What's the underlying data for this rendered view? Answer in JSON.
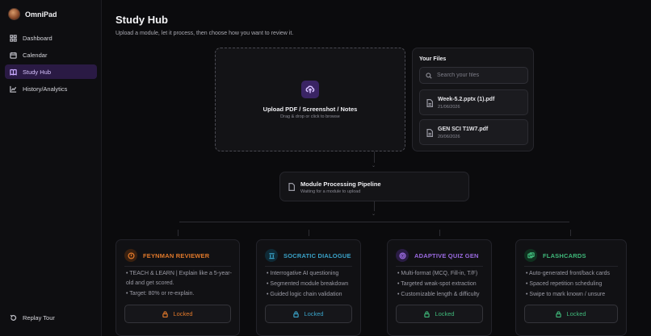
{
  "app": {
    "name": "OmniPad"
  },
  "sidebar": {
    "items": [
      {
        "label": "Dashboard",
        "icon": "grid-icon"
      },
      {
        "label": "Calendar",
        "icon": "calendar-icon"
      },
      {
        "label": "Study Hub",
        "icon": "book-icon",
        "active": true
      },
      {
        "label": "History/Analytics",
        "icon": "chart-icon"
      }
    ],
    "replay_label": "Replay Tour"
  },
  "page": {
    "title": "Study Hub",
    "subtitle": "Upload a module, let it process, then choose how you want to review it."
  },
  "upload": {
    "title": "Upload PDF / Screenshot / Notes",
    "subtitle": "Drag & drop or click to browse"
  },
  "files": {
    "title": "Your Files",
    "search_placeholder": "Search your files",
    "items": [
      {
        "name": "Week-5.2.pptx (1).pdf",
        "date": "21/06/2026"
      },
      {
        "name": "GEN SCI T1W7.pdf",
        "date": "20/06/2026"
      }
    ]
  },
  "pipeline": {
    "title": "Module Processing Pipeline",
    "status": "Waiting for a module to upload"
  },
  "modes": [
    {
      "title": "FEYNMAN REVIEWER",
      "color": "#e0782a",
      "icon": "lightbulb-icon",
      "bullets": [
        "• TEACH & LEARN | Explain like a 5-year-old and get scored.",
        "• Target: 80% or re-explain."
      ],
      "button": "Locked"
    },
    {
      "title": "SOCRATIC DIALOGUE",
      "color": "#3aa3c9",
      "icon": "columns-icon",
      "bullets": [
        "• Interrogative AI questioning",
        "• Segmented module breakdown",
        "• Guided logic chain validation"
      ],
      "button": "Locked"
    },
    {
      "title": "ADAPTIVE QUIZ GEN",
      "color": "#9a6ae0",
      "icon": "target-icon",
      "bullets": [
        "• Multi-format (MCQ, Fill-in, T/F)",
        "• Targeted weak-spot extraction",
        "• Customizable length & difficulty"
      ],
      "button": "Locked"
    },
    {
      "title": "FLASHCARDS",
      "color": "#3fb87a",
      "icon": "cards-icon",
      "bullets": [
        "• Auto-generated front/back cards",
        "• Spaced repetition scheduling",
        "• Swipe to mark known / unsure"
      ],
      "button": "Locked"
    }
  ]
}
